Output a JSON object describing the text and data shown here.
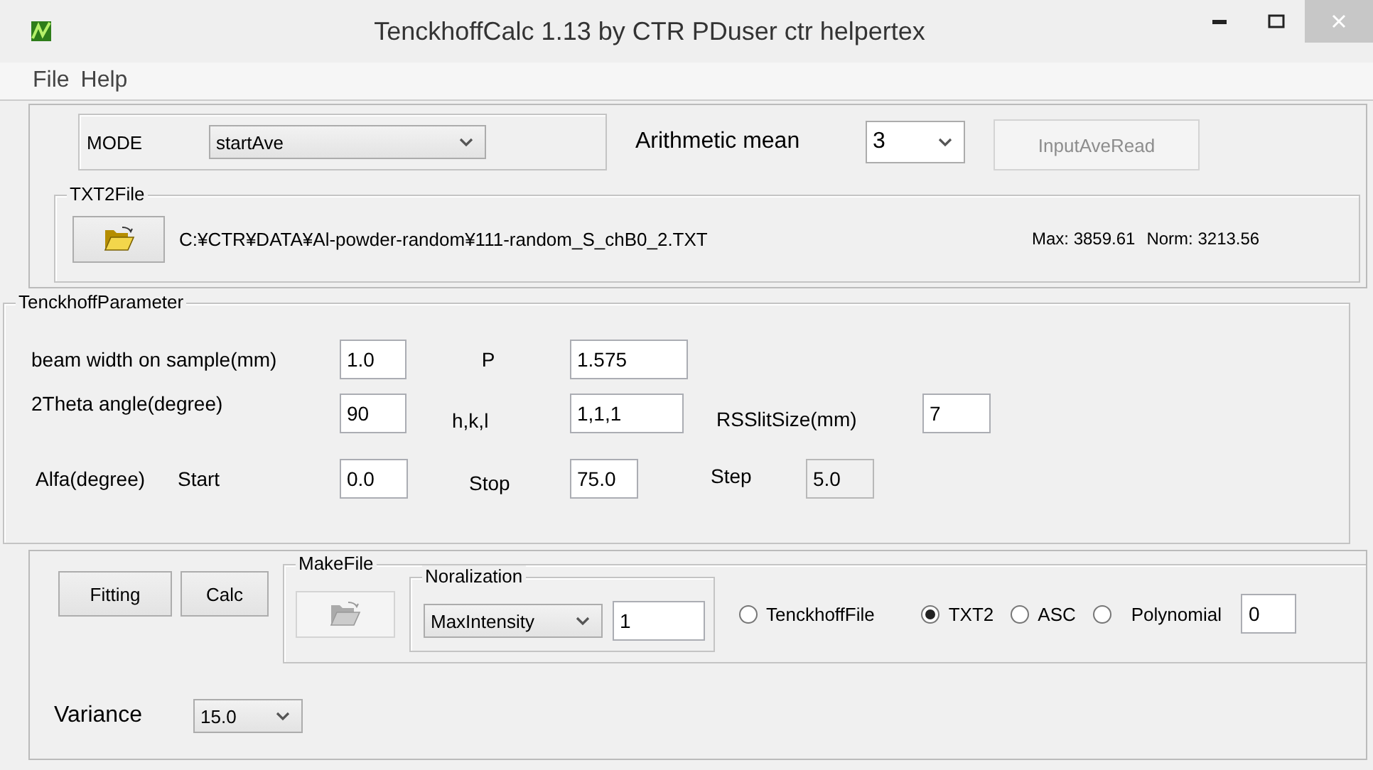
{
  "window": {
    "title": "TenckhoffCalc 1.13 by CTR PDuser ctr helpertex"
  },
  "menu": [
    "File",
    "Help"
  ],
  "mode": {
    "label": "MODE",
    "value": "startAve"
  },
  "arithmetic_mean": {
    "label": "Arithmetic mean",
    "value": "3"
  },
  "input_ave_read": {
    "label": "InputAveRead",
    "disabled": true
  },
  "txt2file": {
    "title": "TXT2File",
    "path": "C:¥CTR¥DATA¥Al-powder-random¥111-random_S_chB0_2.TXT",
    "max": "Max: 3859.61",
    "norm": "Norm: 3213.56"
  },
  "tenckhoff_parameter": {
    "title": "TenckhoffParameter",
    "beam_width": {
      "label": "beam width on sample(mm)",
      "value": "1.0"
    },
    "p": {
      "label": "P",
      "value": "1.575"
    },
    "two_theta": {
      "label": "2Theta angle(degree)",
      "value": "90"
    },
    "hkl": {
      "label": "h,k,l",
      "value": "1,1,1"
    },
    "rs_slit": {
      "label": "RSSlitSize(mm)",
      "value": "7"
    },
    "alfa": {
      "label": "Alfa(degree)"
    },
    "start": {
      "label": "Start",
      "value": "0.0"
    },
    "stop": {
      "label": "Stop",
      "value": "75.0"
    },
    "step": {
      "label": "Step",
      "value": "5.0",
      "disabled": true
    }
  },
  "buttons": [
    {
      "label": "Fitting"
    },
    {
      "label": "Calc"
    }
  ],
  "make_file": {
    "title": "MakeFile",
    "folder_disabled": true,
    "normalization": {
      "title": "Noralization",
      "value": "MaxIntensity",
      "field": "1"
    },
    "formats": [
      {
        "label": "TenckhoffFile",
        "selected": false
      },
      {
        "label": "TXT2",
        "selected": true
      },
      {
        "label": "ASC",
        "selected": false
      },
      {
        "label": "Polynomial",
        "selected": false
      }
    ],
    "polynomial_value": "0"
  },
  "variance": {
    "label": "Variance",
    "value": "15.0"
  }
}
